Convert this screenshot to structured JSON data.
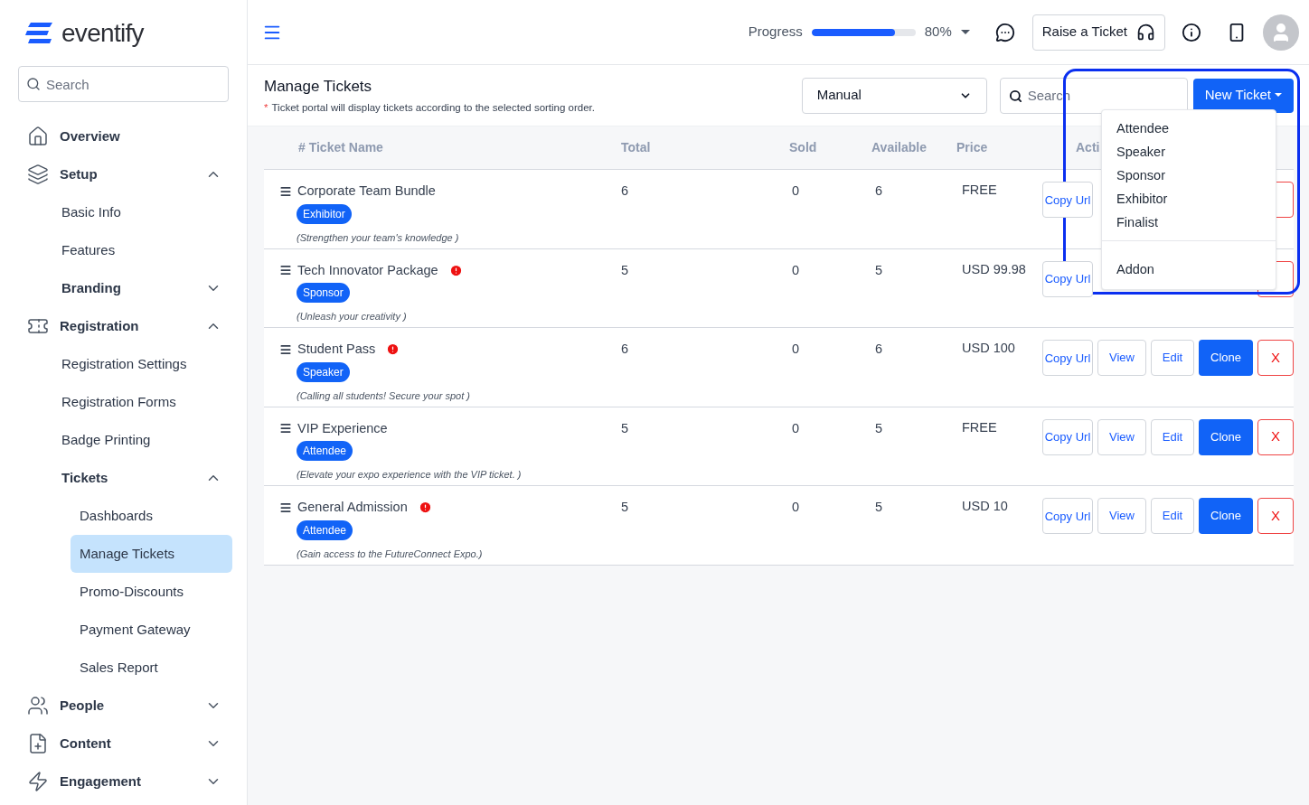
{
  "brand": {
    "name": "eventify"
  },
  "sidebar": {
    "search": {
      "placeholder": "Search"
    },
    "items": [
      {
        "label": "Overview",
        "kind": "link",
        "selected": false
      },
      {
        "label": "Setup",
        "kind": "group",
        "selected": false,
        "expanded": true,
        "children": [
          {
            "label": "Basic Info",
            "kind": "link",
            "selected": false
          },
          {
            "label": "Features",
            "kind": "link",
            "selected": false
          },
          {
            "label": "Branding",
            "kind": "group",
            "selected": false,
            "expanded": false
          }
        ]
      },
      {
        "label": "Registration",
        "kind": "group",
        "selected": false,
        "expanded": true,
        "children": [
          {
            "label": "Registration Settings",
            "kind": "link",
            "selected": false
          },
          {
            "label": "Registration Forms",
            "kind": "link",
            "selected": false
          },
          {
            "label": "Badge Printing",
            "kind": "link",
            "selected": false
          },
          {
            "label": "Tickets",
            "kind": "group",
            "selected": false,
            "expanded": true,
            "children": [
              {
                "label": "Dashboards",
                "kind": "link",
                "selected": false
              },
              {
                "label": "Manage Tickets",
                "kind": "link",
                "selected": true
              },
              {
                "label": "Promo-Discounts",
                "kind": "link",
                "selected": false
              },
              {
                "label": "Payment Gateway",
                "kind": "link",
                "selected": false
              },
              {
                "label": "Sales Report",
                "kind": "link",
                "selected": false
              }
            ]
          }
        ]
      },
      {
        "label": "People",
        "kind": "group",
        "selected": false,
        "expanded": false
      },
      {
        "label": "Content",
        "kind": "group",
        "selected": false,
        "expanded": false
      },
      {
        "label": "Engagement",
        "kind": "group",
        "selected": false,
        "expanded": false
      }
    ]
  },
  "topbar": {
    "progress": {
      "label": "Progress",
      "level": 0.8,
      "reading": "80%"
    },
    "raise_ticket": "Raise a Ticket"
  },
  "page": {
    "title": "Manage Tickets",
    "note_mark": "*",
    "note": "Ticket portal will display tickets according to the selected sorting order.",
    "sort": {
      "value": "Manual"
    },
    "search": {
      "placeholder": "Search"
    },
    "new_ticket": "New Ticket"
  },
  "table": {
    "columns": [
      "# Ticket Name",
      "Total",
      "Sold",
      "Available",
      "Price",
      "Acti"
    ],
    "rows": [
      {
        "name": "Corporate Team Bundle",
        "warning": false,
        "tag": "Exhibitor",
        "description": "(Strengthen your team's knowledge )",
        "total": "6",
        "sold": "0",
        "available": "6",
        "price": "FREE",
        "actions": [
          {
            "label": "Copy Url",
            "kind": "copy"
          },
          {
            "kind": "delete"
          }
        ]
      },
      {
        "name": "Tech Innovator Package",
        "warning": true,
        "tag": "Sponsor",
        "description": "(Unleash your creativity )",
        "total": "5",
        "sold": "0",
        "available": "5",
        "price": "USD 99.98",
        "actions": [
          {
            "label": "Copy Url",
            "kind": "copy"
          },
          {
            "kind": "delete"
          }
        ]
      },
      {
        "name": "Student Pass",
        "warning": true,
        "tag": "Speaker",
        "description": "(Calling all students! Secure your spot )",
        "total": "6",
        "sold": "0",
        "available": "6",
        "price": "USD 100",
        "actions": [
          {
            "label": "Copy Url",
            "kind": "copy"
          },
          {
            "label": "View",
            "kind": "view"
          },
          {
            "label": "Edit",
            "kind": "edit"
          },
          {
            "label": "Clone",
            "kind": "clone"
          },
          {
            "label": "X",
            "kind": "delete"
          }
        ]
      },
      {
        "name": "VIP Experience",
        "warning": false,
        "tag": "Attendee",
        "description": "(Elevate your expo experience with the VIP ticket. )",
        "total": "5",
        "sold": "0",
        "available": "5",
        "price": "FREE",
        "actions": [
          {
            "label": "Copy Url",
            "kind": "copy"
          },
          {
            "label": "View",
            "kind": "view"
          },
          {
            "label": "Edit",
            "kind": "edit"
          },
          {
            "label": "Clone",
            "kind": "clone"
          },
          {
            "label": "X",
            "kind": "delete"
          }
        ]
      },
      {
        "name": "General Admission",
        "warning": true,
        "tag": "Attendee",
        "description": "(Gain access to the FutureConnect Expo.)",
        "total": "5",
        "sold": "0",
        "available": "5",
        "price": "USD 10",
        "actions": [
          {
            "label": "Copy Url",
            "kind": "copy"
          },
          {
            "label": "View",
            "kind": "view"
          },
          {
            "label": "Edit",
            "kind": "edit"
          },
          {
            "label": "Clone",
            "kind": "clone"
          },
          {
            "label": "X",
            "kind": "delete"
          }
        ]
      }
    ]
  },
  "dropdown": {
    "items": [
      "Attendee",
      "Speaker",
      "Sponsor",
      "Exhibitor",
      "Finalist"
    ],
    "extra_items": [
      "Addon"
    ]
  }
}
